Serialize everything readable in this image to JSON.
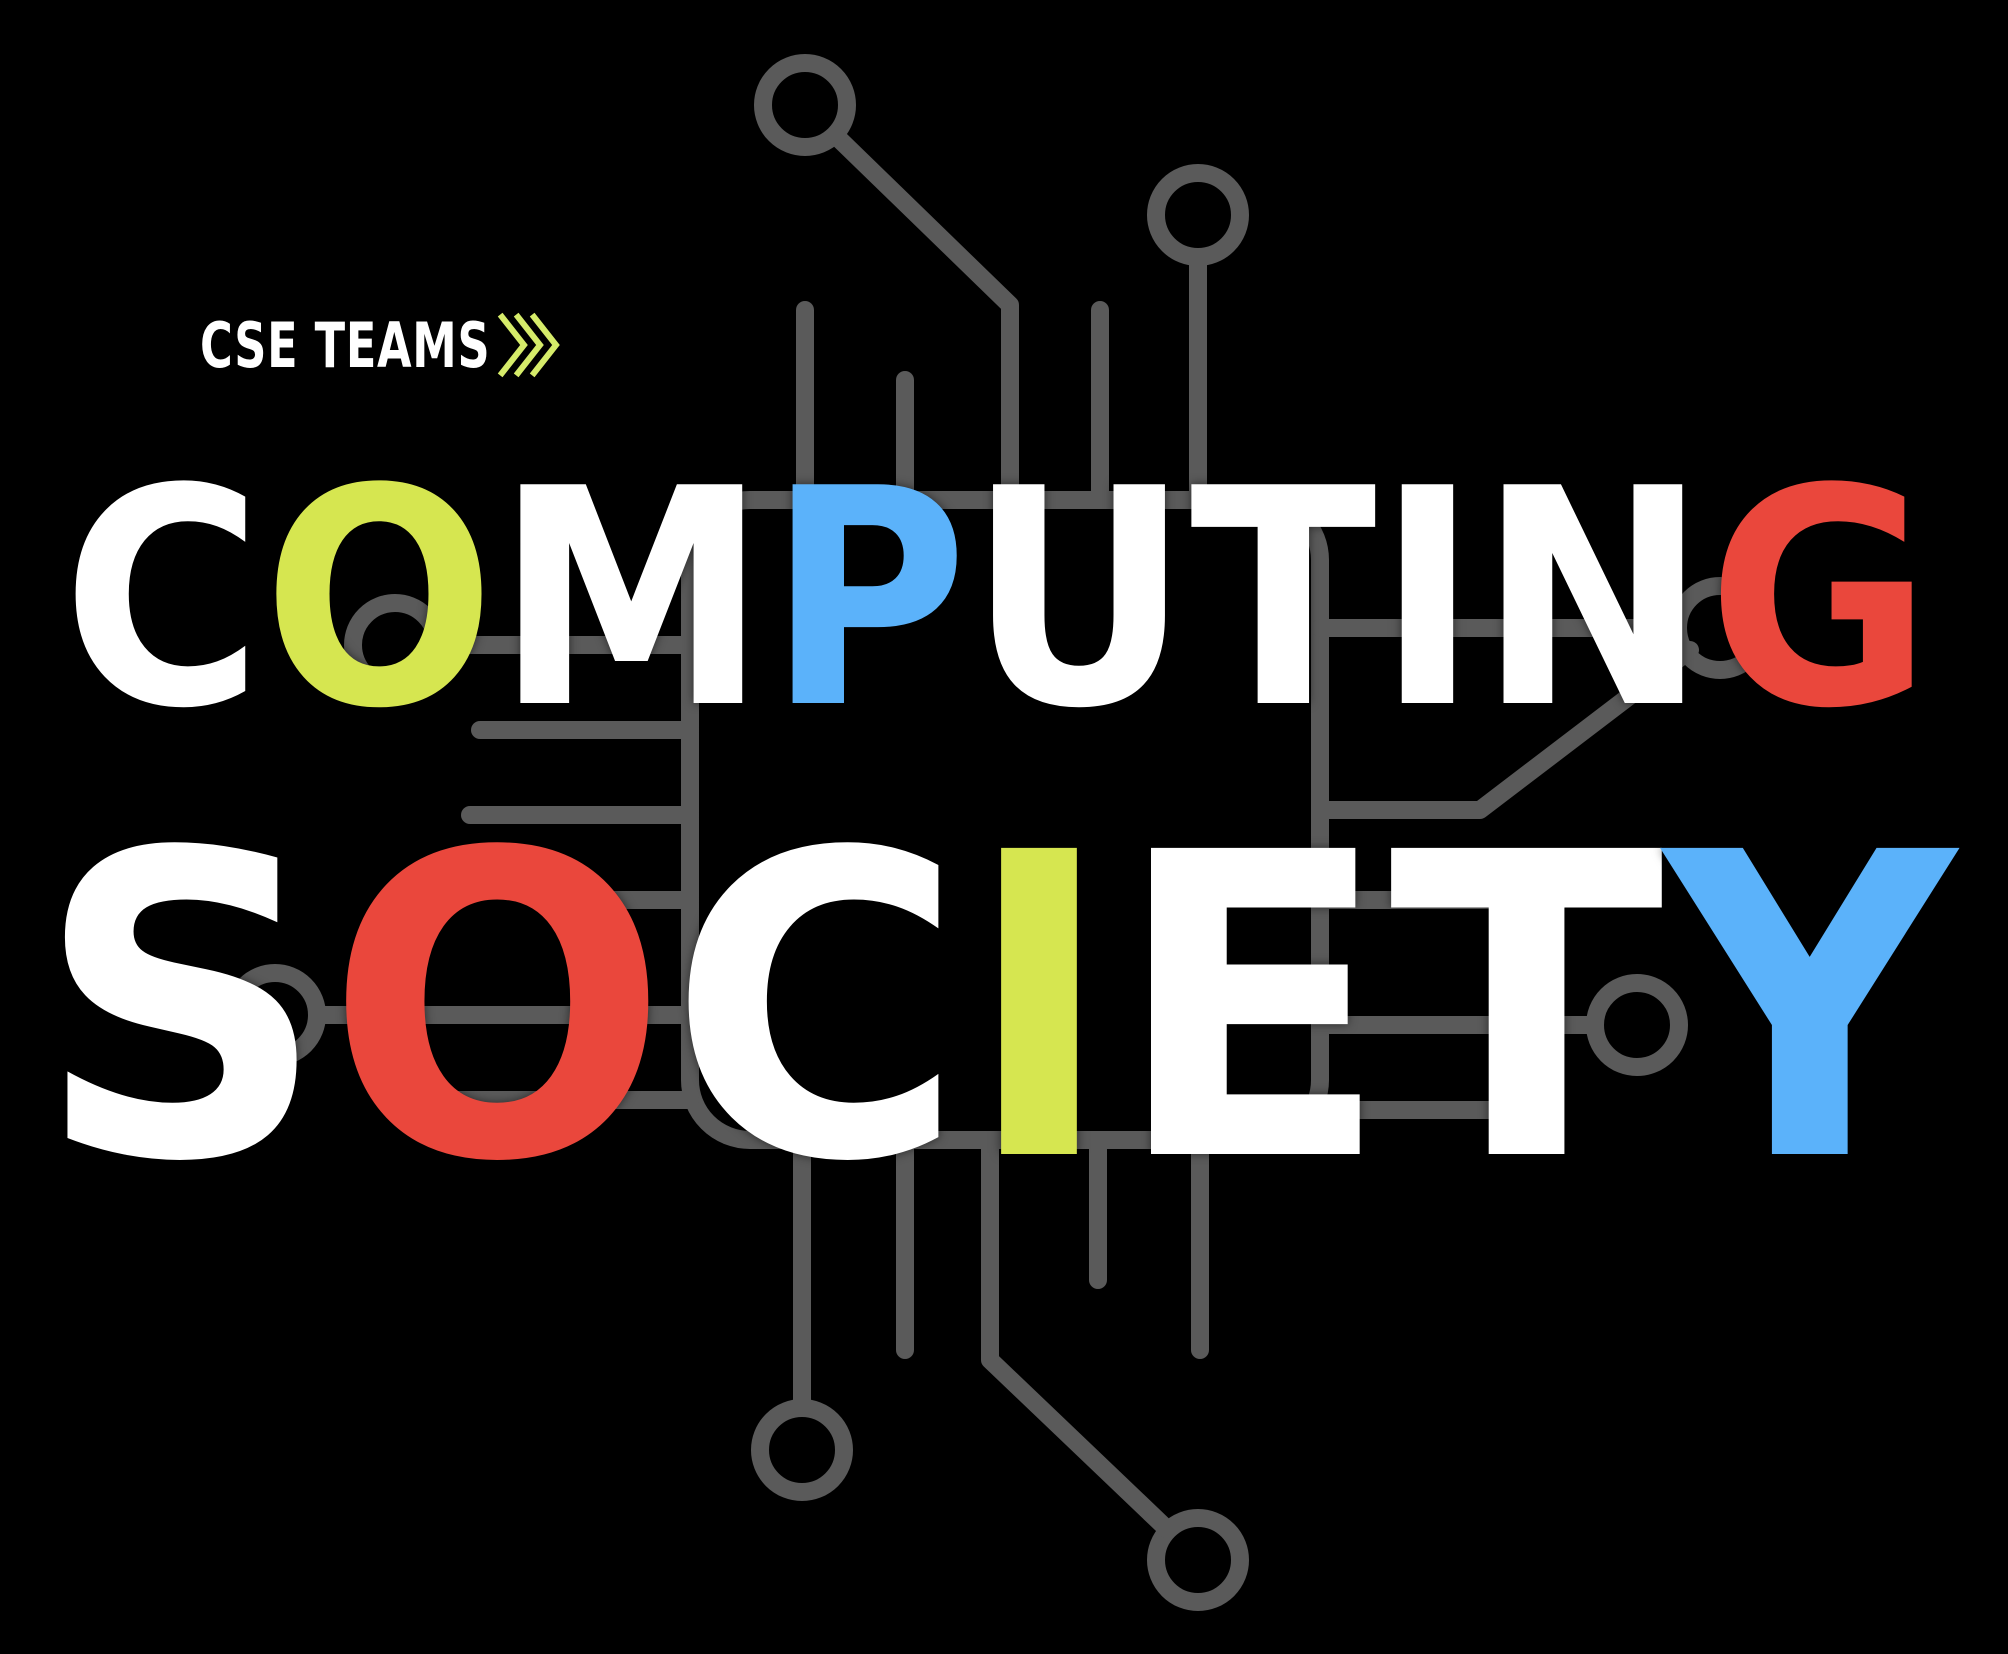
{
  "tag": {
    "label": "CSE TEAMS",
    "icon": "double-chevron-right-icon",
    "icon_color": "#d6ec6a"
  },
  "title": {
    "line1": [
      {
        "char": "C",
        "color": "#ffffff"
      },
      {
        "char": "O",
        "color": "#d6e650"
      },
      {
        "char": "M",
        "color": "#ffffff"
      },
      {
        "char": "P",
        "color": "#5bb2fa"
      },
      {
        "char": "U",
        "color": "#ffffff"
      },
      {
        "char": "T",
        "color": "#ffffff"
      },
      {
        "char": "I",
        "color": "#ffffff"
      },
      {
        "char": "N",
        "color": "#ffffff"
      },
      {
        "char": "G",
        "color": "#ea473c"
      }
    ],
    "line2": [
      {
        "char": "S",
        "color": "#ffffff"
      },
      {
        "char": "O",
        "color": "#ea473c"
      },
      {
        "char": "C",
        "color": "#ffffff"
      },
      {
        "char": "I",
        "color": "#d6e650"
      },
      {
        "char": "E",
        "color": "#ffffff"
      },
      {
        "char": "T",
        "color": "#ffffff"
      },
      {
        "char": "Y",
        "color": "#5bb2fa"
      }
    ]
  },
  "background": {
    "color": "#000000",
    "circuit_color": "#5a5a5a",
    "icon": "circuit-chip-icon"
  }
}
